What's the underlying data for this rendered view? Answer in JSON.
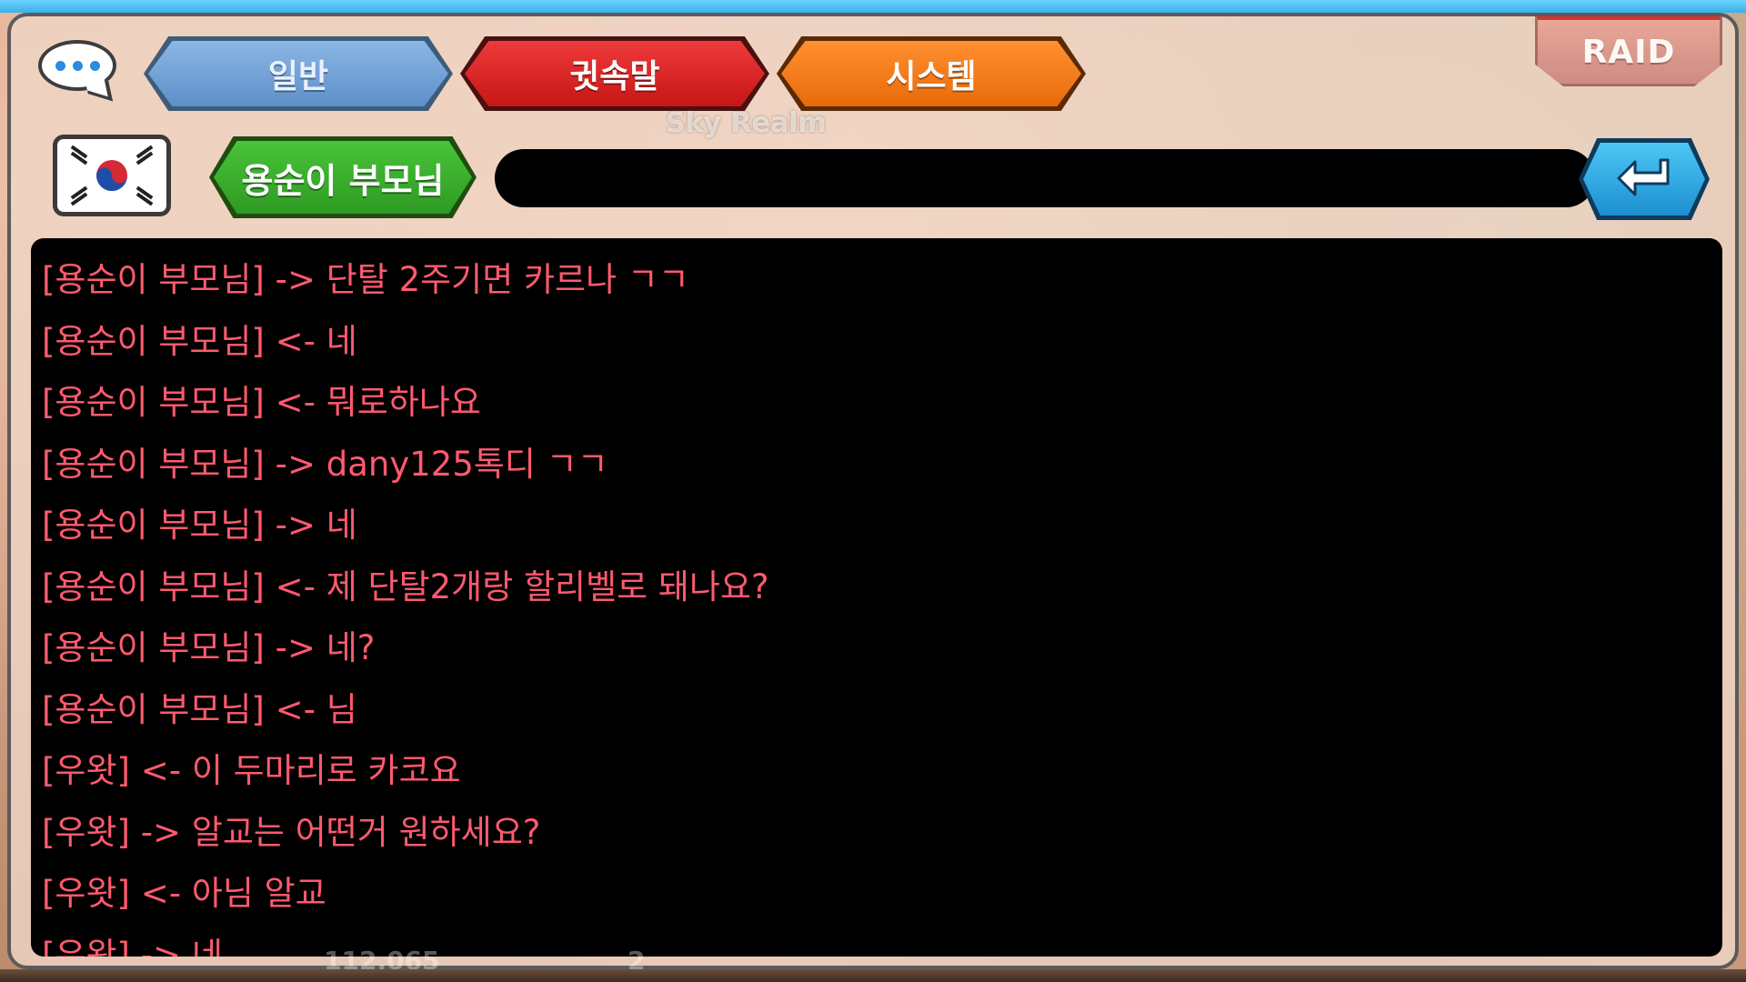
{
  "tabs": {
    "general": "일반",
    "whisper": "귓속말",
    "system": "시스템"
  },
  "raid_label": "RAID",
  "background_text": "Sky Realm",
  "recipient": "용순이 부모님",
  "input": {
    "value": "",
    "placeholder": ""
  },
  "messages": [
    "[용순이 부모님] -> 단탈 2주기면 카르나 ㄱㄱ",
    "[용순이 부모님] <- 네",
    "[용순이 부모님] <- 뭐로하나요",
    "[용순이 부모님] -> dany125톡디 ㄱㄱ",
    "[용순이 부모님] -> 네",
    "[용순이 부모님] <- 제 단탈2개랑 할리벨로 돼나요?",
    "[용순이 부모님] -> 네?",
    "[용순이 부모님] <- 님",
    "[우왓] <- 이 두마리로 카코요",
    "[우왓] -> 알교는 어떤거 원하세요?",
    "[우왓] <- 아님 알교",
    "[우왓] -> 네"
  ],
  "bottom": {
    "currency": "112,065",
    "count": "2"
  },
  "colors": {
    "message_text": "#ff5a6e",
    "tab_general": "#6a9bd3",
    "tab_whisper": "#d81f1f",
    "tab_system": "#f07a12",
    "recipient_button": "#37ad2b",
    "send_button": "#2aa6e0"
  },
  "icons": {
    "chat": "speech-bubble-icon",
    "flag": "korea-flag-icon",
    "send": "enter-return-icon"
  }
}
